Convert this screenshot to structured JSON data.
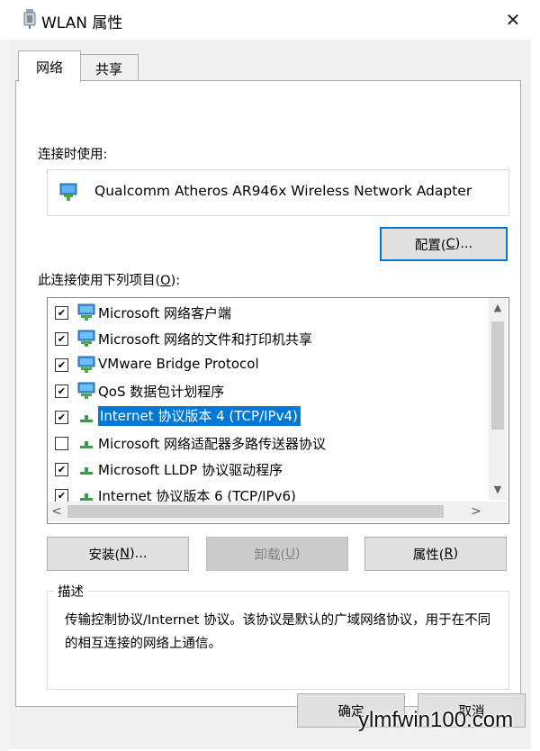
{
  "window": {
    "title": "WLAN 属性",
    "close_glyph": "✕"
  },
  "tabs": [
    {
      "label": "网络",
      "active": true
    },
    {
      "label": "共享",
      "active": false
    }
  ],
  "connect_using_label": "连接时使用:",
  "adapter_name": "Qualcomm Atheros AR946x Wireless Network Adapter",
  "configure_button": {
    "prefix": "配置(",
    "accel": "C",
    "suffix": ")..."
  },
  "items_label": {
    "prefix": "此连接使用下列项目(",
    "accel": "O",
    "suffix": "):"
  },
  "items": [
    {
      "label": "Microsoft 网络客户端",
      "checked": true,
      "icon": "network-client-icon",
      "selected": false
    },
    {
      "label": "Microsoft 网络的文件和打印机共享",
      "checked": true,
      "icon": "network-client-icon",
      "selected": false
    },
    {
      "label": "VMware Bridge Protocol",
      "checked": true,
      "icon": "network-client-icon",
      "selected": false
    },
    {
      "label": "QoS 数据包计划程序",
      "checked": true,
      "icon": "network-client-icon",
      "selected": false
    },
    {
      "label": "Internet 协议版本 4 (TCP/IPv4)",
      "checked": true,
      "icon": "protocol-icon",
      "selected": true
    },
    {
      "label": "Microsoft 网络适配器多路传送器协议",
      "checked": false,
      "icon": "protocol-icon",
      "selected": false
    },
    {
      "label": "Microsoft LLDP 协议驱动程序",
      "checked": true,
      "icon": "protocol-icon",
      "selected": false
    },
    {
      "label": "Internet 协议版本 6 (TCP/IPv6)",
      "checked": true,
      "icon": "protocol-icon",
      "selected": false
    }
  ],
  "scroll_glyphs": {
    "up": "▲",
    "down": "▼",
    "left": "<",
    "right": ">"
  },
  "install_button": {
    "prefix": "安装(",
    "accel": "N",
    "suffix": ")..."
  },
  "uninstall_button": {
    "prefix": "卸载(",
    "accel": "U",
    "suffix": ")",
    "enabled": false
  },
  "properties_button": {
    "prefix": "属性(",
    "accel": "R",
    "suffix": ")"
  },
  "description": {
    "title": "描述",
    "text": "传输控制协议/Internet 协议。该协议是默认的广域网络协议，用于在不同的相互连接的网络上通信。"
  },
  "ok_button": "确定",
  "cancel_button": "取消",
  "watermark": "ylmfwin100.com",
  "colors": {
    "selection": "#0078d7",
    "focus_border": "#0078d7",
    "dialog_bg": "#f0f0f0"
  }
}
